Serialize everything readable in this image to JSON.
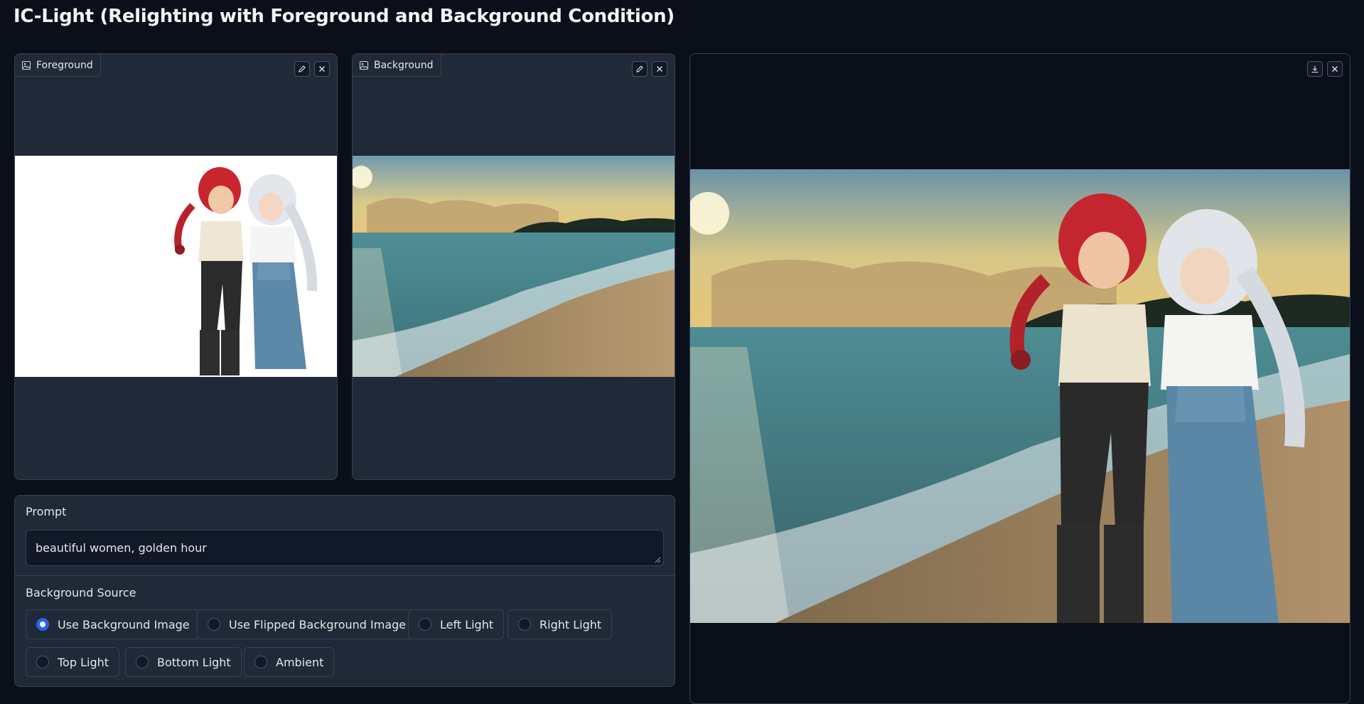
{
  "page": {
    "title": "IC-Light (Relighting with Foreground and Background Condition)"
  },
  "foreground": {
    "label": "Foreground"
  },
  "background": {
    "label": "Background"
  },
  "prompt": {
    "label": "Prompt",
    "value": "beautiful women, golden hour"
  },
  "bg_source": {
    "label": "Background Source",
    "options": [
      {
        "label": "Use Background Image",
        "selected": true
      },
      {
        "label": "Use Flipped Background Image",
        "selected": false
      },
      {
        "label": "Left Light",
        "selected": false
      },
      {
        "label": "Right Light",
        "selected": false
      },
      {
        "label": "Top Light",
        "selected": false
      },
      {
        "label": "Bottom Light",
        "selected": false
      },
      {
        "label": "Ambient",
        "selected": false
      }
    ]
  },
  "icons": {
    "image": "image-icon",
    "edit": "pencil-icon",
    "clear": "close-icon",
    "download": "download-icon"
  },
  "colors": {
    "accent": "#2563eb",
    "panel": "#1f2937",
    "page": "#0b0f19"
  }
}
